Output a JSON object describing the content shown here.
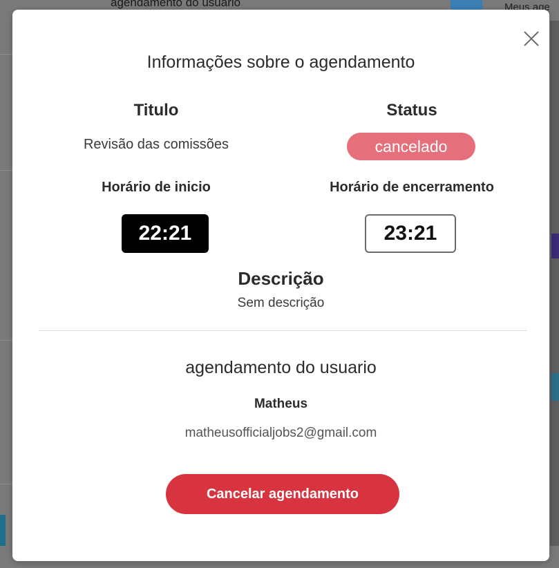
{
  "background": {
    "top_text": "agendamento do usuario",
    "top_right_text": "Meus age"
  },
  "modal": {
    "title": "Informações sobre o agendamento",
    "close_icon": "close-icon",
    "title_label": "Titulo",
    "title_value": "Revisão das comissões",
    "status_label": "Status",
    "status_value": "cancelado",
    "status_color": "#e5707b",
    "start_label": "Horário de inicio",
    "start_time": "22:21",
    "end_label": "Horário de encerramento",
    "end_time": "23:21",
    "description_label": "Descrição",
    "description_value": "Sem descrição",
    "user_section_title": "agendamento do usuario",
    "user_name": "Matheus",
    "user_email": "matheusofficialjobs2@gmail.com",
    "cancel_button_label": "Cancelar agendamento",
    "cancel_button_color": "#d8343f"
  }
}
